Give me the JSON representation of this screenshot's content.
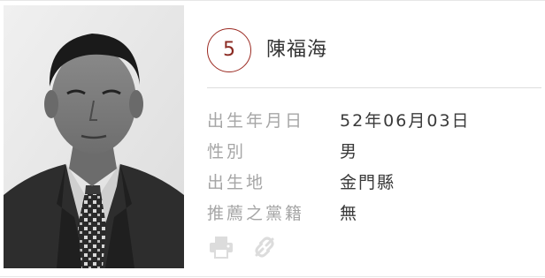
{
  "candidate": {
    "number": "5",
    "name": "陳福海"
  },
  "details": [
    {
      "label": "出生年月日",
      "value": "52年06月03日"
    },
    {
      "label": "性別",
      "value": "男"
    },
    {
      "label": "出生地",
      "value": "金門縣"
    },
    {
      "label": "推薦之黨籍",
      "value": "無"
    }
  ],
  "icons": {
    "print": "print-icon",
    "link": "link-icon"
  },
  "colors": {
    "accent": "#9b2a22",
    "label": "#a6a6a6",
    "value": "#3a3a3a",
    "icon": "#dcdcdc"
  }
}
